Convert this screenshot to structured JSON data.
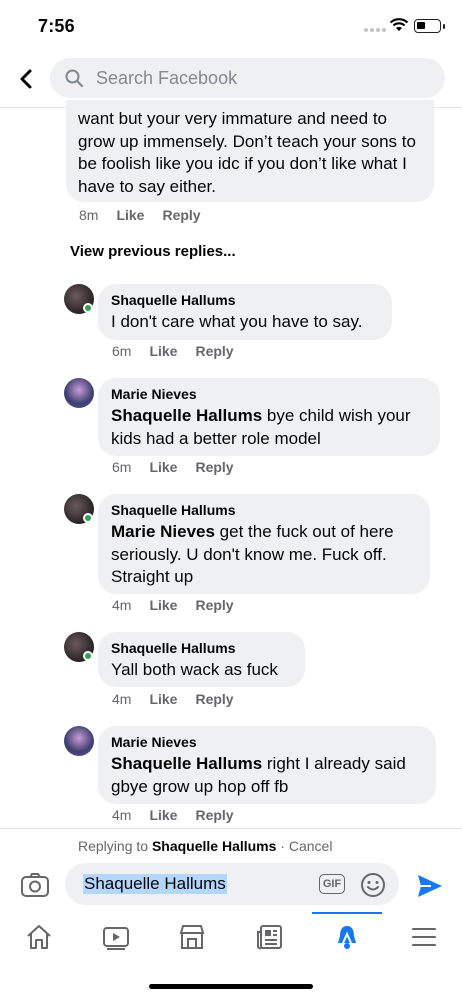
{
  "status_bar": {
    "time": "7:56"
  },
  "header": {
    "search_placeholder": "Search Facebook"
  },
  "prev_comment": {
    "text": "want but your very immature and need to grow up immensely. Don’t teach your sons to be foolish like you idc if you don’t like what I have to say either.",
    "time": "8m",
    "like": "Like",
    "reply": "Reply"
  },
  "view_previous": "View previous replies...",
  "comments": [
    {
      "name": "Shaquelle Hallums",
      "tag": "",
      "text": "I don't care what you have to say.",
      "time": "6m",
      "like": "Like",
      "reply": "Reply"
    },
    {
      "name": "Marie Nieves",
      "tag": "Shaquelle Hallums",
      "text": " bye child wish your kids had a better role model",
      "time": "6m",
      "like": "Like",
      "reply": "Reply"
    },
    {
      "name": "Shaquelle Hallums",
      "tag": "Marie Nieves",
      "text": " get the fuck out of here seriously. U don't know me. Fuck off. Straight up",
      "time": "4m",
      "like": "Like",
      "reply": "Reply"
    },
    {
      "name": "Shaquelle Hallums",
      "tag": "",
      "text": "Yall both wack as fuck",
      "time": "4m",
      "like": "Like",
      "reply": "Reply"
    },
    {
      "name": "Marie Nieves",
      "tag": "Shaquelle Hallums",
      "text": " right I already said gbye grow up hop off fb",
      "time": "4m",
      "like": "Like",
      "reply": "Reply"
    }
  ],
  "reply_bar": {
    "replying_to_prefix": "Replying to ",
    "replying_to_name": "Shaquelle Hallums",
    "cancel": " · Cancel",
    "input_value": "Shaquelle Hallums",
    "gif_label": "GIF"
  },
  "colors": {
    "accent": "#1877f2",
    "online": "#31a24c",
    "bubble": "#eff0f2",
    "meta": "#65676b"
  },
  "icons": [
    "back-arrow-icon",
    "search-icon",
    "camera-icon",
    "gif-icon",
    "emoji-icon",
    "send-icon",
    "home-icon",
    "watch-icon",
    "marketplace-icon",
    "news-icon",
    "notifications-icon",
    "menu-icon"
  ]
}
